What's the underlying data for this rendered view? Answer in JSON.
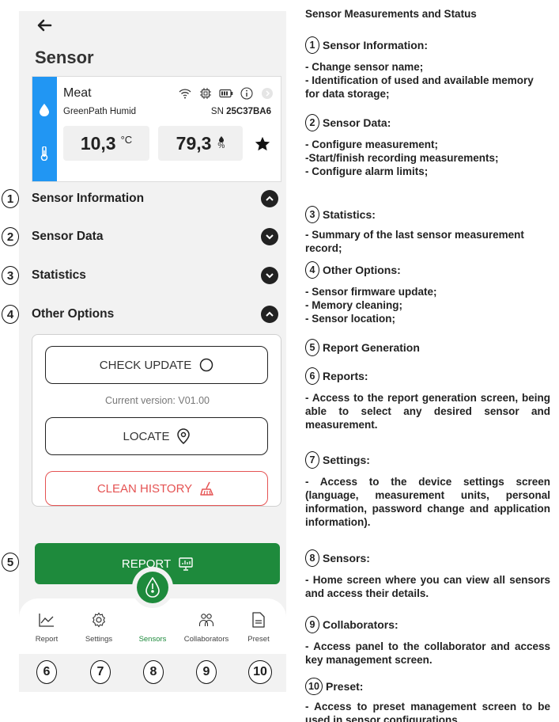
{
  "phone": {
    "title": "Sensor",
    "sensor": {
      "name": "Meat",
      "model": "GreenPath Humid",
      "sn_prefix": "SN ",
      "sn": "25C37BA6",
      "temperature": "10,3",
      "temperature_unit": "°C",
      "humidity": "79,3",
      "humidity_unit": "%"
    },
    "sections": [
      {
        "num": "1",
        "label": "Sensor Information",
        "state": "expanded"
      },
      {
        "num": "2",
        "label": "Sensor Data",
        "state": "collapsed"
      },
      {
        "num": "3",
        "label": "Statistics",
        "state": "collapsed"
      },
      {
        "num": "4",
        "label": "Other Options",
        "state": "expanded"
      }
    ],
    "options": {
      "check_update": "CHECK UPDATE",
      "version": "Current version: V01.00",
      "locate": "LOCATE",
      "clean_history": "CLEAN HISTORY"
    },
    "report": {
      "num": "5",
      "label": "REPORT"
    },
    "nav": [
      {
        "num": "6",
        "label": "Report",
        "icon": "chart-line-icon"
      },
      {
        "num": "7",
        "label": "Settings",
        "icon": "gear-icon"
      },
      {
        "num": "8",
        "label": "Sensors",
        "icon": "sensor-drop-icon",
        "active": true
      },
      {
        "num": "9",
        "label": "Collaborators",
        "icon": "people-icon"
      },
      {
        "num": "10",
        "label": "Preset",
        "icon": "document-icon"
      }
    ],
    "colors": {
      "accent": "#1e8a3c",
      "strip": "#2196f3",
      "danger": "#e55353"
    }
  },
  "doc": {
    "title": "Sensor Measurements and Status",
    "items": [
      {
        "num": "1",
        "head": "Sensor Information:",
        "body": "- Change sensor name;\n- Identification of used and available memory for data storage;"
      },
      {
        "num": "2",
        "head": "Sensor Data:",
        "body": "- Configure measurement;\n-Start/finish recording measurements;\n- Configure alarm limits;"
      },
      {
        "num": "3",
        "head": "Statistics:",
        "body": "- Summary of the last sensor measurement record;"
      },
      {
        "num": "4",
        "head": "Other Options:",
        "body": "- Sensor firmware update;\n- Memory cleaning;\n- Sensor location;"
      },
      {
        "num": "5",
        "head": "Report Generation",
        "body": ""
      },
      {
        "num": "6",
        "head": "Reports:",
        "body": "- Access to the report generation screen, being able to select any desired sensor and measurement."
      },
      {
        "num": "7",
        "head": "Settings:",
        "body": "- Access to the device settings screen (language, measurement units, personal information, password change and application information)."
      },
      {
        "num": "8",
        "head": "Sensors:",
        "body": "- Home screen where you can view all sensors and access their details."
      },
      {
        "num": "9",
        "head": "Collaborators:",
        "body": "- Access panel to the collaborator and access key management screen."
      },
      {
        "num": "10",
        "head": "Preset:",
        "body": "- Access to preset management screen to be used in sensor configurations."
      }
    ]
  }
}
